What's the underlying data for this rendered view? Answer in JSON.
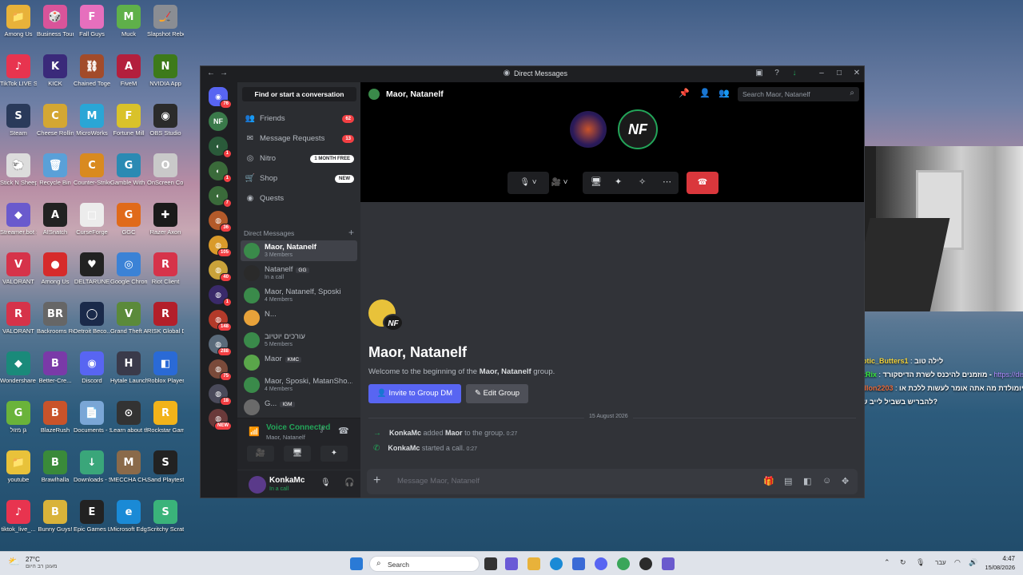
{
  "desktop": {
    "icons": [
      {
        "label": "Among Us",
        "color": "#e8b23a",
        "glyph": "📁"
      },
      {
        "label": "Business Tour - Online Mu...",
        "color": "#d9549a",
        "glyph": "🎲"
      },
      {
        "label": "Fall Guys",
        "color": "#e66fbd",
        "glyph": "F"
      },
      {
        "label": "Muck",
        "color": "#5fb04a",
        "glyph": "M"
      },
      {
        "label": "Slapshot Rebound",
        "color": "#8a8d93",
        "glyph": "🏒"
      },
      {
        "label": "TikTok LIVE Studio",
        "color": "#e8344f",
        "glyph": "♪"
      },
      {
        "label": "KICK",
        "color": "#3a2a7a",
        "glyph": "K"
      },
      {
        "label": "Chained Together",
        "color": "#a24b2a",
        "glyph": "⛓"
      },
      {
        "label": "FiveM",
        "color": "#b31f3d",
        "glyph": "A"
      },
      {
        "label": "NVIDIA App",
        "color": "#3d7a1a",
        "glyph": "N"
      },
      {
        "label": "Steam",
        "color": "#2a3a5a",
        "glyph": "S"
      },
      {
        "label": "Cheese Rolling",
        "color": "#d4a733",
        "glyph": "C"
      },
      {
        "label": "MicroWorks",
        "color": "#2aa6d6",
        "glyph": "M"
      },
      {
        "label": "Fortune Mill",
        "color": "#d9c22a",
        "glyph": "F"
      },
      {
        "label": "OBS Studio",
        "color": "#2b2b2b",
        "glyph": "◉"
      },
      {
        "label": "Stick N Sheep Demo",
        "color": "#dcdcdc",
        "glyph": "🐑"
      },
      {
        "label": "Recycle Bin",
        "color": "#5aa0d8",
        "glyph": "🗑"
      },
      {
        "label": "Counter-Strike 2",
        "color": "#d98a1f",
        "glyph": "C"
      },
      {
        "label": "Gamble With Your Friends",
        "color": "#2b8ab3",
        "glyph": "G"
      },
      {
        "label": "OnScreen Control",
        "color": "#c9c9c9",
        "glyph": "O"
      },
      {
        "label": "Streamer.bot Shortcut",
        "color": "#6a5acd",
        "glyph": "◆"
      },
      {
        "label": "AISnatch",
        "color": "#222222",
        "glyph": "A"
      },
      {
        "label": "CurseForge",
        "color": "#ececec",
        "glyph": "□"
      },
      {
        "label": "GGC",
        "color": "#e06a1a",
        "glyph": "G"
      },
      {
        "label": "Razer Axon",
        "color": "#1a1a1a",
        "glyph": "✚"
      },
      {
        "label": "VALORANT",
        "color": "#d6334a",
        "glyph": "V"
      },
      {
        "label": "Among Us",
        "color": "#d62b2b",
        "glyph": "●"
      },
      {
        "label": "DELTARUNE",
        "color": "#222222",
        "glyph": "♥"
      },
      {
        "label": "Google Chrome",
        "color": "#3b82d6",
        "glyph": "◎"
      },
      {
        "label": "Riot Client",
        "color": "#d6334a",
        "glyph": "R"
      },
      {
        "label": "VALORANT",
        "color": "#d6334a",
        "glyph": "R"
      },
      {
        "label": "Backrooms Rec.",
        "color": "#666666",
        "glyph": "BR"
      },
      {
        "label": "Detroit Beco...",
        "color": "#1a2a4a",
        "glyph": "◯"
      },
      {
        "label": "Grand Theft Auto V Le...",
        "color": "#5b8a3a",
        "glyph": "V"
      },
      {
        "label": "RISK Global Domination",
        "color": "#b31f2a",
        "glyph": "R"
      },
      {
        "label": "Wondershare Filmora 15",
        "color": "#1a8a7a",
        "glyph": "◆"
      },
      {
        "label": "Better-Cre...",
        "color": "#7a3aa8",
        "glyph": "B"
      },
      {
        "label": "Discord",
        "color": "#5865f2",
        "glyph": "◉"
      },
      {
        "label": "Hytale Launcher",
        "color": "#3a3a4a",
        "glyph": "H"
      },
      {
        "label": "Roblox Player",
        "color": "#2a6ad6",
        "glyph": "◧"
      },
      {
        "label": "גן מזול",
        "color": "#6ab33a",
        "glyph": "G"
      },
      {
        "label": "BlazeRush",
        "color": "#c9532a",
        "glyph": "B"
      },
      {
        "label": "Documents - Shortcut",
        "color": "#7aa6d6",
        "glyph": "📄"
      },
      {
        "label": "Learn about this picture",
        "color": "#333333",
        "glyph": "⊙"
      },
      {
        "label": "Rockstar Games...",
        "color": "#f2b31a",
        "glyph": "R"
      },
      {
        "label": "youtube",
        "color": "#e8c23a",
        "glyph": "📁"
      },
      {
        "label": "Brawlhalla",
        "color": "#3a8a3a",
        "glyph": "B"
      },
      {
        "label": "Downloads - Shortcut",
        "color": "#3aa67a",
        "glyph": "↓"
      },
      {
        "label": "MECCHA CHAMELEON",
        "color": "#8a6a4a",
        "glyph": "M"
      },
      {
        "label": "Sand Playtest",
        "color": "#222222",
        "glyph": "S"
      },
      {
        "label": "tiktok_live_...",
        "color": "#e8344f",
        "glyph": "♪"
      },
      {
        "label": "Bunny Guys!",
        "color": "#d9b33a",
        "glyph": "B"
      },
      {
        "label": "Epic Games Launcher",
        "color": "#222222",
        "glyph": "E"
      },
      {
        "label": "Microsoft Edge",
        "color": "#1a8ad6",
        "glyph": "e"
      },
      {
        "label": "Scritchy Scratc...",
        "color": "#3ab37a",
        "glyph": "S"
      },
      {
        "label": "גשדגשד",
        "color": "#dcdcdc",
        "glyph": "□"
      }
    ]
  },
  "window": {
    "title": "Direct Messages",
    "back_glyph": "←",
    "fwd_glyph": "→"
  },
  "servers": [
    {
      "badge": "76",
      "color": "#5865f2",
      "glyph": "◉"
    },
    {
      "badge": "",
      "color": "#3a7a4a",
      "glyph": "NF"
    },
    {
      "badge": "1",
      "color": "#2a5a3a",
      "glyph": "◐"
    },
    {
      "badge": "1",
      "color": "#3a6a3a",
      "glyph": "◐"
    },
    {
      "badge": "7",
      "color": "#3a6a3a",
      "glyph": "◐"
    },
    {
      "badge": "36",
      "color": "#b35a2a",
      "glyph": "◍"
    },
    {
      "badge": "105",
      "color": "#d99a2a",
      "glyph": "◍"
    },
    {
      "badge": "40",
      "color": "#c9a23a",
      "glyph": "◍"
    },
    {
      "badge": "1",
      "color": "#3a2a6a",
      "glyph": "◍"
    },
    {
      "badge": "148",
      "color": "#b33a2a",
      "glyph": "◍"
    },
    {
      "badge": "288",
      "color": "#5a6a7a",
      "glyph": "◍"
    },
    {
      "badge": "75",
      "color": "#7a4a3a",
      "glyph": "◍"
    },
    {
      "badge": "18",
      "color": "#4a4a5a",
      "glyph": "◍"
    },
    {
      "badge": "NEW",
      "color": "#6a3a3a",
      "glyph": "◍"
    }
  ],
  "dm_panel": {
    "search_label": "Find or start a conversation",
    "nav": [
      {
        "icon": "👥",
        "label": "Friends",
        "badge": "62",
        "kind": "red"
      },
      {
        "icon": "✉",
        "label": "Message Requests",
        "badge": "13",
        "kind": "red"
      },
      {
        "icon": "◎",
        "label": "Nitro",
        "badge": "1 MONTH FREE",
        "kind": "white"
      },
      {
        "icon": "🛒",
        "label": "Shop",
        "badge": "NEW",
        "kind": "white"
      },
      {
        "icon": "◉",
        "label": "Quests",
        "badge": "",
        "kind": ""
      }
    ],
    "dm_header": "Direct Messages",
    "add_glyph": "+",
    "dms": [
      {
        "name": "Maor, Natanelf",
        "sub": "3 Members",
        "color": "#3a8a4a",
        "active": true
      },
      {
        "name": "Natanelf",
        "sub": "In a call",
        "color": "#2a2a2a",
        "tag": "GG"
      },
      {
        "name": "Maor, Natanelf, Sposki",
        "sub": "4 Members",
        "color": "#3a8a4a"
      },
      {
        "name": "N...",
        "sub": "",
        "color": "#e8a23a"
      },
      {
        "name": "עורכים יוטיוב",
        "sub": "5 Members",
        "color": "#3a8a4a"
      },
      {
        "name": "Maor",
        "sub": "",
        "color": "#5aa64a",
        "tag": "KMC"
      },
      {
        "name": "Maor, Sposki, MatanSho...",
        "sub": "4 Members",
        "color": "#3a8a4a"
      },
      {
        "name": "G...",
        "sub": "",
        "color": "#6a6a6a",
        "tag": "IGM"
      }
    ],
    "voice": {
      "status": "Voice Connected",
      "channel": "Maor, Natanelf",
      "icons": [
        "🎥",
        "🖥",
        "✦",
        "✧"
      ]
    },
    "user": {
      "name": "KonkaMc",
      "status": "In a call",
      "mic_glyph": "🎙",
      "head_glyph": "🎧",
      "gear_glyph": "⚙"
    }
  },
  "main": {
    "header_title": "Maor, Natanelf",
    "search_placeholder": "Search Maor, Natanelf",
    "call_avatar_2": "NF",
    "hang_glyph": "☎",
    "welcome_title": "Maor, Natanelf",
    "welcome_text": "Welcome to the beginning of the ",
    "welcome_bold": "Maor, Natanelf",
    "welcome_end": " group.",
    "invite_label": "Invite to Group DM",
    "edit_label": "Edit Group",
    "date_divider": "15 August 2026",
    "system_msgs": [
      {
        "glyph": "→",
        "actor": "KonkaMc",
        "mid": " added ",
        "target": "Maor",
        "end": " to the group.",
        "time": "0:27"
      },
      {
        "glyph": "✆",
        "actor": "KonkaMc",
        "mid": " started a call.",
        "target": "",
        "end": "",
        "time": "0:27"
      }
    ],
    "message_placeholder": "Message Maor, Natanelf",
    "plus_glyph": "+"
  },
  "overlay_chat": [
    {
      "user": "Exotic_Butters1",
      "sep": " : ",
      "msg": "לילה טוב",
      "color": "#f2d23a",
      "link": ""
    },
    {
      "user": "BotRix",
      "sep": " : ",
      "msg": "מוזמנים להיכנס לשרת הדיסקורד - ",
      "color": "#3ae83a",
      "link": "https://discord"
    },
    {
      "user": "Fadlon2203",
      "sep": " : ",
      "msg": "אמא שלי יומולדת מה אתה אומר לעשות ללכת או",
      "color": "#e86a3a",
      "link": ""
    },
    {
      "user": "",
      "sep": "",
      "msg": "להבריש בשביל לייב שלך?",
      "color": "#ffffff",
      "link": ""
    }
  ],
  "taskbar": {
    "weather_temp": "27°C",
    "weather_desc": "מעונן רב היום",
    "search_label": "Search",
    "lang": "עבר",
    "time": "4:47",
    "date": "15/08/2026"
  }
}
